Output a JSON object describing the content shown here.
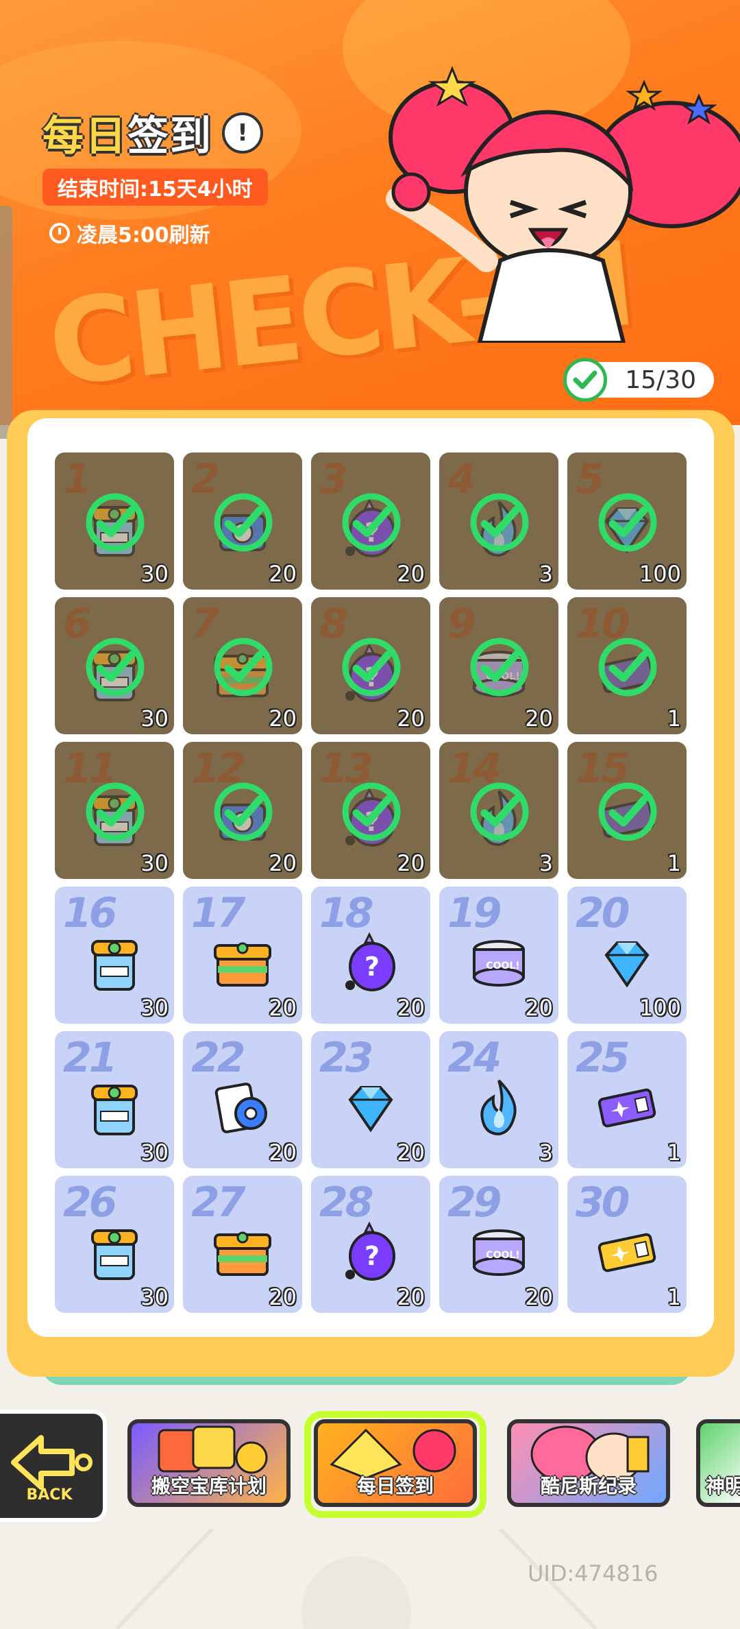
{
  "header": {
    "title_part1": "每日",
    "title_part2": "签到",
    "info_icon": "exclamation-icon",
    "end_time": "结束时间:15天4小时",
    "refresh": "凌晨5:00刷新",
    "banner_text": "CHECK-IN"
  },
  "progress": {
    "text": "15/30",
    "checked": 15,
    "total": 30
  },
  "days": [
    {
      "day": "1",
      "qty": "30",
      "item": "paint-bucket",
      "done": true
    },
    {
      "day": "2",
      "qty": "20",
      "item": "blue-box",
      "done": true
    },
    {
      "day": "3",
      "qty": "20",
      "item": "purple-egg",
      "done": true
    },
    {
      "day": "4",
      "qty": "3",
      "item": "blue-flame",
      "done": true
    },
    {
      "day": "5",
      "qty": "100",
      "item": "diamond",
      "done": true
    },
    {
      "day": "6",
      "qty": "30",
      "item": "paint-bucket",
      "done": true
    },
    {
      "day": "7",
      "qty": "20",
      "item": "treasure-box",
      "done": true
    },
    {
      "day": "8",
      "qty": "20",
      "item": "purple-egg",
      "done": true
    },
    {
      "day": "9",
      "qty": "20",
      "item": "cool-can",
      "done": true
    },
    {
      "day": "10",
      "qty": "1",
      "item": "ticket",
      "done": true
    },
    {
      "day": "11",
      "qty": "30",
      "item": "paint-bucket",
      "done": true
    },
    {
      "day": "12",
      "qty": "20",
      "item": "blue-box",
      "done": true
    },
    {
      "day": "13",
      "qty": "20",
      "item": "purple-egg",
      "done": true
    },
    {
      "day": "14",
      "qty": "3",
      "item": "blue-flame",
      "done": true
    },
    {
      "day": "15",
      "qty": "1",
      "item": "ticket",
      "done": true
    },
    {
      "day": "16",
      "qty": "30",
      "item": "paint-bucket",
      "done": false
    },
    {
      "day": "17",
      "qty": "20",
      "item": "treasure-box",
      "done": false
    },
    {
      "day": "18",
      "qty": "20",
      "item": "purple-egg",
      "done": false
    },
    {
      "day": "19",
      "qty": "20",
      "item": "cool-can",
      "done": false
    },
    {
      "day": "20",
      "qty": "100",
      "item": "diamond",
      "done": false
    },
    {
      "day": "21",
      "qty": "30",
      "item": "paint-bucket",
      "done": false
    },
    {
      "day": "22",
      "qty": "20",
      "item": "film-roll",
      "done": false
    },
    {
      "day": "23",
      "qty": "20",
      "item": "diamond",
      "done": false
    },
    {
      "day": "24",
      "qty": "3",
      "item": "blue-flame",
      "done": false
    },
    {
      "day": "25",
      "qty": "1",
      "item": "purple-ticket",
      "done": false
    },
    {
      "day": "26",
      "qty": "30",
      "item": "paint-bucket",
      "done": false
    },
    {
      "day": "27",
      "qty": "20",
      "item": "treasure-box",
      "done": false
    },
    {
      "day": "28",
      "qty": "20",
      "item": "purple-egg",
      "done": false
    },
    {
      "day": "29",
      "qty": "20",
      "item": "cool-can",
      "done": false
    },
    {
      "day": "30",
      "qty": "1",
      "item": "gold-ticket",
      "done": false
    }
  ],
  "nav": {
    "back_label": "BACK",
    "cards": [
      {
        "label": "搬空宝库计划"
      },
      {
        "label": "每日签到"
      },
      {
        "label": "酷尼斯纪录"
      },
      {
        "label": "神明"
      }
    ]
  },
  "uid": "UID:474816",
  "colors": {
    "header_orange": "#ff7d1f",
    "board_yellow": "#ffcc55",
    "done_cell": "#7d6a4a",
    "todo_cell": "#c9d3f7",
    "check_green": "#2fdc6a",
    "active_frame": "#c6ff2e"
  }
}
